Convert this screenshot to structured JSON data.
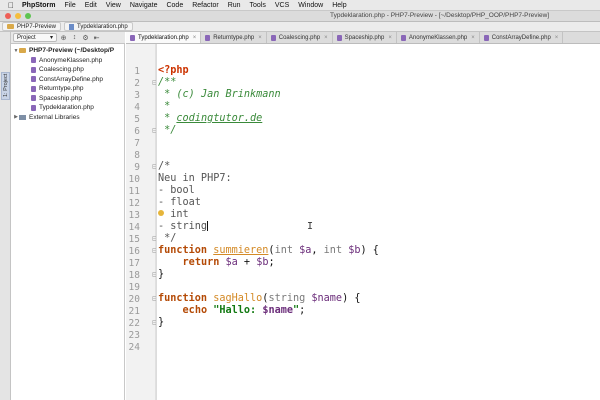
{
  "menubar": {
    "app_name": "PhpStorm",
    "items": [
      "File",
      "Edit",
      "View",
      "Navigate",
      "Code",
      "Refactor",
      "Run",
      "Tools",
      "VCS",
      "Window",
      "Help"
    ]
  },
  "window": {
    "title": "Typdeklaration.php - PHP7-Preview - [~/Desktop/PHP_OOP/PHP7-Preview]"
  },
  "breadcrumb": {
    "project": "PHP7-Preview",
    "file": "Typdeklaration.php"
  },
  "tool_window": {
    "side_tab": "1: Project",
    "dropdown_label": "Project",
    "root": "PHP7-Preview (~/Desktop/P",
    "files": [
      "AnonymeKlassen.php",
      "Coalescing.php",
      "ConstArrayDefine.php",
      "Returntype.php",
      "Spaceship.php",
      "Typdeklaration.php"
    ],
    "external": "External Libraries"
  },
  "tabs": [
    {
      "label": "Typdeklaration.php",
      "active": true
    },
    {
      "label": "Returntype.php",
      "active": false
    },
    {
      "label": "Coalescing.php",
      "active": false
    },
    {
      "label": "Spaceship.php",
      "active": false
    },
    {
      "label": "AnonymeKlassen.php",
      "active": false
    },
    {
      "label": "ConstArrayDefine.php",
      "active": false
    }
  ],
  "editor": {
    "line_numbers": [
      "1",
      "2",
      "3",
      "4",
      "5",
      "6",
      "7",
      "8",
      "9",
      "10",
      "11",
      "12",
      "13",
      "14",
      "15",
      "16",
      "17",
      "18",
      "19",
      "20",
      "21",
      "22",
      "23",
      "24"
    ],
    "code": {
      "l1": "<?php",
      "l2": "/**",
      "l3_prefix": " * ",
      "l3_text": "(c) Jan Brinkmann",
      "l4": " *",
      "l5_prefix": " * ",
      "l5_text": "codingtutor.de",
      "l6": " */",
      "l9": "/*",
      "l10": "Neu in PHP7:",
      "l11": "- bool",
      "l12": "- float",
      "l13": "- int",
      "l14": "- string",
      "l15": " */",
      "l16_kw": "function",
      "l16_fn": "summieren",
      "l16_open": "(",
      "l16_t1": "int",
      "l16_v1": "$a",
      "l16_comma": ", ",
      "l16_t2": "int",
      "l16_v2": "$b",
      "l16_close": ") {",
      "l17_kw": "return",
      "l17_v1": "$a",
      "l17_op": " + ",
      "l17_v2": "$b",
      "l17_end": ";",
      "l18": "}",
      "l20_kw": "function",
      "l20_fn": "sagHallo",
      "l20_open": "(",
      "l20_t1": "string",
      "l20_v1": "$name",
      "l20_close": ") {",
      "l21_kw": "echo",
      "l21_str1": "\"Hallo: ",
      "l21_var": "$name",
      "l21_str2": "\"",
      "l21_end": ";",
      "l22": "}"
    }
  },
  "colors": {
    "keyword": "#000080",
    "function_name": "#d48a26",
    "variable": "#6b2d7a",
    "doc_comment": "#3a8a3a",
    "string": "#127a12"
  },
  "icons": {
    "apple": "apple-logo-icon",
    "settings": "gear-icon",
    "collapse": "collapse-icon",
    "target": "scroll-from-source-icon",
    "pin": "hide-icon"
  }
}
